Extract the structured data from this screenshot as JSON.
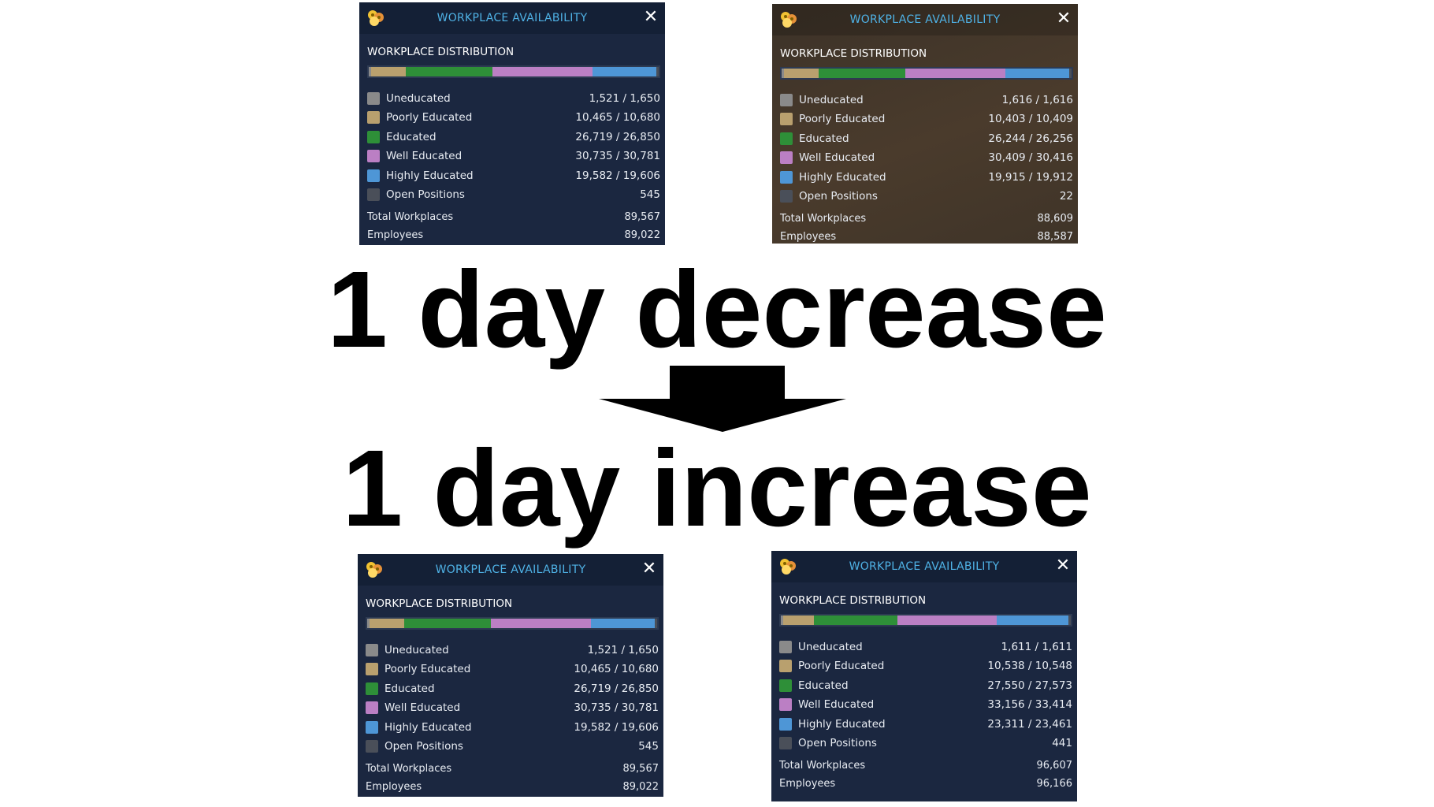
{
  "colors": {
    "uneducated": "#8a8a8a",
    "poorly_educated": "#b9a06e",
    "educated": "#2e8f38",
    "well_educated": "#bb7fc4",
    "highly_educated": "#4e96d6",
    "open_positions": "#4a4f59",
    "header_title": "#4fb2e6"
  },
  "panels": [
    {
      "title": "WORKPLACE AVAILABILITY",
      "close_glyph": "✕",
      "distribution_title": "WORKPLACE DISTRIBUTION",
      "bar_shares": [
        0.7,
        12,
        30,
        34.5,
        22,
        0.8
      ],
      "rows": [
        {
          "label": "Uneducated",
          "value": "1,521 / 1,650"
        },
        {
          "label": "Poorly Educated",
          "value": "10,465 / 10,680"
        },
        {
          "label": "Educated",
          "value": "26,719 / 26,850"
        },
        {
          "label": "Well Educated",
          "value": "30,735 / 30,781"
        },
        {
          "label": "Highly Educated",
          "value": "19,582 / 19,606"
        },
        {
          "label": "Open Positions",
          "value": "545"
        }
      ],
      "totals": [
        {
          "label": "Total Workplaces",
          "value": "89,567"
        },
        {
          "label": "Employees",
          "value": "89,022"
        }
      ]
    },
    {
      "title": "WORKPLACE AVAILABILITY",
      "close_glyph": "✕",
      "distribution_title": "WORKPLACE DISTRIBUTION",
      "bar_shares": [
        0.7,
        12,
        30,
        34.5,
        22,
        0.8
      ],
      "rows": [
        {
          "label": "Uneducated",
          "value": "1,616 / 1,616"
        },
        {
          "label": "Poorly Educated",
          "value": "10,403 / 10,409"
        },
        {
          "label": "Educated",
          "value": "26,244 / 26,256"
        },
        {
          "label": "Well Educated",
          "value": "30,409 / 30,416"
        },
        {
          "label": "Highly Educated",
          "value": "19,915 / 19,912"
        },
        {
          "label": "Open Positions",
          "value": "22"
        }
      ],
      "totals": [
        {
          "label": "Total Workplaces",
          "value": "88,609"
        },
        {
          "label": "Employees",
          "value": "88,587"
        }
      ]
    },
    {
      "title": "WORKPLACE AVAILABILITY",
      "close_glyph": "✕",
      "distribution_title": "WORKPLACE DISTRIBUTION",
      "bar_shares": [
        0.7,
        12,
        30,
        34.5,
        22,
        0.8
      ],
      "rows": [
        {
          "label": "Uneducated",
          "value": "1,521 / 1,650"
        },
        {
          "label": "Poorly Educated",
          "value": "10,465 / 10,680"
        },
        {
          "label": "Educated",
          "value": "26,719 / 26,850"
        },
        {
          "label": "Well Educated",
          "value": "30,735 / 30,781"
        },
        {
          "label": "Highly Educated",
          "value": "19,582 / 19,606"
        },
        {
          "label": "Open Positions",
          "value": "545"
        }
      ],
      "totals": [
        {
          "label": "Total Workplaces",
          "value": "89,567"
        },
        {
          "label": "Employees",
          "value": "89,022"
        }
      ]
    },
    {
      "title": "WORKPLACE AVAILABILITY",
      "close_glyph": "✕",
      "distribution_title": "WORKPLACE DISTRIBUTION",
      "bar_shares": [
        0.7,
        11,
        29,
        35,
        25,
        0.8
      ],
      "rows": [
        {
          "label": "Uneducated",
          "value": "1,611 / 1,611"
        },
        {
          "label": "Poorly Educated",
          "value": "10,538 / 10,548"
        },
        {
          "label": "Educated",
          "value": "27,550 / 27,573"
        },
        {
          "label": "Well Educated",
          "value": "33,156 / 33,414"
        },
        {
          "label": "Highly Educated",
          "value": "23,311 / 23,461"
        },
        {
          "label": "Open Positions",
          "value": "441"
        }
      ],
      "totals": [
        {
          "label": "Total Workplaces",
          "value": "96,607"
        },
        {
          "label": "Employees",
          "value": "96,166"
        }
      ]
    }
  ],
  "captions": {
    "top": "1 day decrease",
    "bottom": "1 day increase"
  }
}
